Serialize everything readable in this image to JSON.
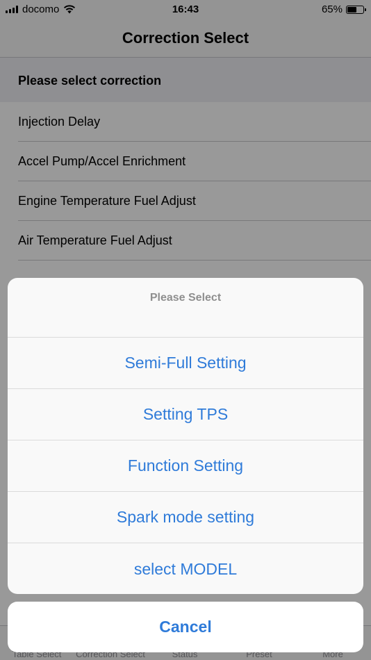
{
  "status_bar": {
    "carrier": "docomo",
    "time": "16:43",
    "battery_percent": "65%",
    "battery_level": 0.65
  },
  "nav": {
    "title": "Correction Select"
  },
  "section": {
    "header": "Please select correction"
  },
  "list": {
    "items": [
      {
        "label": "Injection Delay"
      },
      {
        "label": "Accel Pump/Accel Enrichment"
      },
      {
        "label": "Engine Temperature Fuel Adjust"
      },
      {
        "label": "Air Temperature Fuel Adjust"
      }
    ]
  },
  "tab_bar": {
    "items": [
      {
        "label": "Table Select"
      },
      {
        "label": "Correction Select"
      },
      {
        "label": "Status"
      },
      {
        "label": "Preset"
      },
      {
        "label": "More"
      }
    ]
  },
  "action_sheet": {
    "title": "Please Select",
    "options": [
      {
        "label": "Semi-Full Setting"
      },
      {
        "label": "Setting TPS"
      },
      {
        "label": "Function Setting"
      },
      {
        "label": "Spark mode setting"
      },
      {
        "label": "select MODEL"
      }
    ],
    "cancel_label": "Cancel"
  },
  "colors": {
    "accent": "#2f7bd9"
  }
}
